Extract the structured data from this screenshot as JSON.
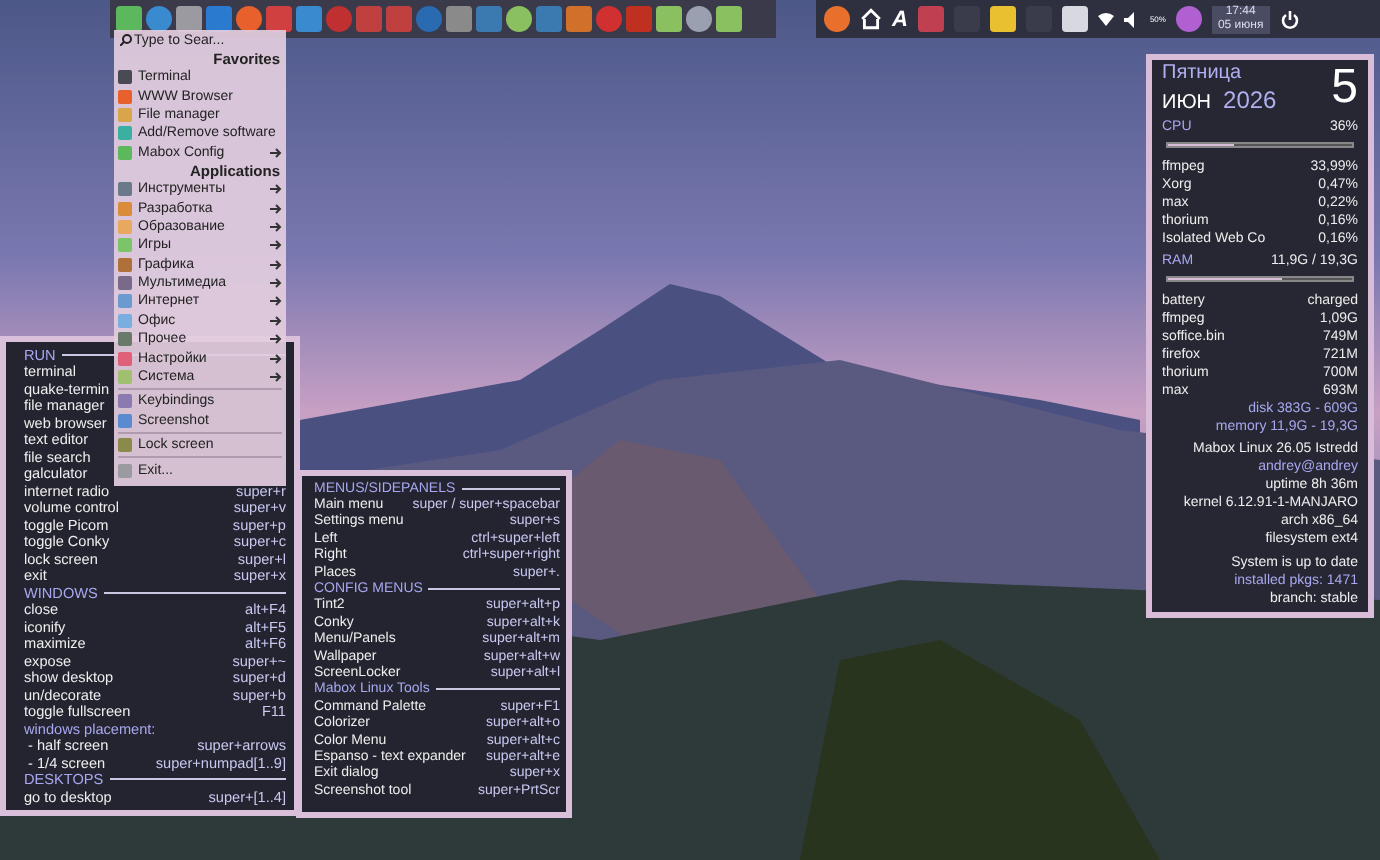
{
  "top_panel": {
    "tray_letter": "A",
    "volume_reading": "50%",
    "clock": {
      "time": "17:44",
      "date": "05 июня"
    }
  },
  "app_menu": {
    "search_placeholder": "Type to Sear...",
    "sections": [
      {
        "title": "Favorites",
        "items": [
          {
            "label": "Terminal",
            "color": "#4a4a55",
            "submenu": false
          },
          {
            "label": "WWW Browser",
            "color": "#e8602c",
            "submenu": false
          },
          {
            "label": "File manager",
            "color": "#d9a54a",
            "submenu": false
          },
          {
            "label": "Add/Remove software",
            "color": "#3bb0a0",
            "submenu": false
          },
          {
            "label": "Mabox Config",
            "color": "#5cb85c",
            "submenu": true
          }
        ]
      },
      {
        "title": "Applications",
        "items": [
          {
            "label": "Инструменты",
            "color": "#6a7a8a",
            "submenu": true
          },
          {
            "label": "Разработка",
            "color": "#d98c3a",
            "submenu": true
          },
          {
            "label": "Образование",
            "color": "#e8a860",
            "submenu": true
          },
          {
            "label": "Игры",
            "color": "#7cc46a",
            "submenu": true
          },
          {
            "label": "Графика",
            "color": "#b0703a",
            "submenu": true
          },
          {
            "label": "Мультимедиа",
            "color": "#7a6a8a",
            "submenu": true
          },
          {
            "label": "Интернет",
            "color": "#6a9ad0",
            "submenu": true
          },
          {
            "label": "Офис",
            "color": "#7aaee0",
            "submenu": true
          },
          {
            "label": "Прочее",
            "color": "#6a7a6a",
            "submenu": true
          },
          {
            "label": "Настройки",
            "color": "#e0607a",
            "submenu": true
          },
          {
            "label": "Система",
            "color": "#a0c070",
            "submenu": true
          }
        ]
      },
      {
        "items": [
          {
            "label": "Keybindings",
            "color": "#8a7ab0",
            "submenu": false
          },
          {
            "label": "Screenshot",
            "color": "#5a8ad0",
            "submenu": false
          }
        ]
      },
      {
        "items": [
          {
            "label": "Lock screen",
            "color": "#8a8a4a",
            "submenu": false
          }
        ]
      },
      {
        "items": [
          {
            "label": "Exit...",
            "color": "#9a9aa0",
            "submenu": false
          }
        ]
      }
    ]
  },
  "left_panel": {
    "rows": [
      {
        "kind": "heading",
        "label": "RUN"
      },
      {
        "kind": "shortcut",
        "label": "terminal"
      },
      {
        "kind": "shortcut",
        "label": "quake-termin"
      },
      {
        "kind": "shortcut",
        "label": "file manager"
      },
      {
        "kind": "shortcut",
        "label": "web browser"
      },
      {
        "kind": "shortcut",
        "label": "text editor"
      },
      {
        "kind": "shortcut",
        "label": "file search"
      },
      {
        "kind": "shortcut",
        "label": "galculator"
      },
      {
        "kind": "shortcut",
        "label": "internet radio",
        "keys": "super+r"
      },
      {
        "kind": "shortcut",
        "label": "volume control",
        "keys": "super+v"
      },
      {
        "kind": "shortcut",
        "label": "toggle Picom",
        "keys": "super+p"
      },
      {
        "kind": "shortcut",
        "label": "toggle Conky",
        "keys": "super+c"
      },
      {
        "kind": "shortcut",
        "label": "lock screen",
        "keys": "super+l"
      },
      {
        "kind": "shortcut",
        "label": "exit",
        "keys": "super+x"
      },
      {
        "kind": "heading",
        "label": "WINDOWS"
      },
      {
        "kind": "shortcut",
        "label": "close",
        "keys": "alt+F4"
      },
      {
        "kind": "shortcut",
        "label": "iconify",
        "keys": "alt+F5"
      },
      {
        "kind": "shortcut",
        "label": "maximize",
        "keys": "alt+F6"
      },
      {
        "kind": "shortcut",
        "label": "expose",
        "keys": "super+~"
      },
      {
        "kind": "shortcut",
        "label": "show desktop",
        "keys": "super+d"
      },
      {
        "kind": "shortcut",
        "label": "un/decorate",
        "keys": "super+b"
      },
      {
        "kind": "shortcut",
        "label": "toggle fullscreen",
        "keys": "F11"
      },
      {
        "kind": "note",
        "label": "windows placement:"
      },
      {
        "kind": "shortcut",
        "label": " - half screen",
        "keys": "super+arrows"
      },
      {
        "kind": "shortcut",
        "label": " - 1/4 screen",
        "keys": "super+numpad[1..9]"
      },
      {
        "kind": "heading",
        "label": "DESKTOPS"
      },
      {
        "kind": "shortcut",
        "label": "go to desktop",
        "keys": "super+[1..4]"
      }
    ]
  },
  "middle_panel": {
    "rows": [
      {
        "kind": "heading",
        "label": "MENUS/SIDEPANELS"
      },
      {
        "kind": "shortcut",
        "label": "Main menu",
        "keys": "super / super+spacebar"
      },
      {
        "kind": "shortcut",
        "label": "Settings menu",
        "keys": "super+s"
      },
      {
        "kind": "shortcut",
        "label": "Left",
        "keys": "ctrl+super+left"
      },
      {
        "kind": "shortcut",
        "label": "Right",
        "keys": "ctrl+super+right"
      },
      {
        "kind": "shortcut",
        "label": "Places",
        "keys": "super+."
      },
      {
        "kind": "heading",
        "label": "CONFIG MENUS"
      },
      {
        "kind": "shortcut",
        "label": "Tint2",
        "keys": "super+alt+p"
      },
      {
        "kind": "shortcut",
        "label": "Conky",
        "keys": "super+alt+k"
      },
      {
        "kind": "shortcut",
        "label": "Menu/Panels",
        "keys": "super+alt+m"
      },
      {
        "kind": "shortcut",
        "label": "Wallpaper",
        "keys": "super+alt+w"
      },
      {
        "kind": "shortcut",
        "label": "ScreenLocker",
        "keys": "super+alt+l"
      },
      {
        "kind": "heading",
        "label": "Mabox Linux Tools"
      },
      {
        "kind": "shortcut",
        "label": "Command Palette",
        "keys": "super+F1"
      },
      {
        "kind": "shortcut",
        "label": "Colorizer",
        "keys": "super+alt+o"
      },
      {
        "kind": "shortcut",
        "label": "Color Menu",
        "keys": "super+alt+c"
      },
      {
        "kind": "shortcut",
        "label": "Espanso - text expander",
        "keys": "super+alt+e"
      },
      {
        "kind": "shortcut",
        "label": "Exit dialog",
        "keys": "super+x"
      },
      {
        "kind": "shortcut",
        "label": "Screenshot tool",
        "keys": "super+PrtScr"
      }
    ]
  },
  "conky": {
    "weekday": "Пятница",
    "month": "ИЮН",
    "year": "2026",
    "day": "5",
    "cpu": {
      "label": "CPU",
      "value": "36%",
      "level": 0.36
    },
    "cpu_processes": [
      {
        "name": "ffmpeg",
        "value": "33,99%"
      },
      {
        "name": "Xorg",
        "value": "0,47%"
      },
      {
        "name": "max",
        "value": "0,22%"
      },
      {
        "name": "thorium",
        "value": "0,16%"
      },
      {
        "name": "Isolated Web Co",
        "value": "0,16%"
      }
    ],
    "ram": {
      "label": "RAM",
      "value": "11,9G / 19,3G",
      "level": 0.62
    },
    "mem_processes": [
      {
        "name": "battery",
        "value": "charged"
      },
      {
        "name": "ffmpeg",
        "value": "1,09G"
      },
      {
        "name": "soffice.bin",
        "value": "749M"
      },
      {
        "name": "firefox",
        "value": "721M"
      },
      {
        "name": "thorium",
        "value": "700M"
      },
      {
        "name": "max",
        "value": "693M"
      }
    ],
    "storage": [
      "disk 383G - 609G",
      "memory 11,9G - 19,3G"
    ],
    "system": [
      {
        "kind": "plain",
        "text": "Mabox Linux 26.05 Istredd"
      },
      {
        "kind": "accent",
        "text": "andrey@andrey"
      },
      {
        "kind": "plain",
        "text": "uptime 8h 36m"
      },
      {
        "kind": "plain",
        "text": "kernel 6.12.91-1-MANJARO"
      },
      {
        "kind": "plain",
        "text": "arch x86_64"
      },
      {
        "kind": "plain",
        "text": "filesystem ext4"
      }
    ],
    "updates": [
      {
        "kind": "plain",
        "text": "System is up to date"
      },
      {
        "kind": "accent",
        "text": "installed pkgs: 1471"
      },
      {
        "kind": "plain",
        "text": "branch: stable"
      }
    ]
  }
}
